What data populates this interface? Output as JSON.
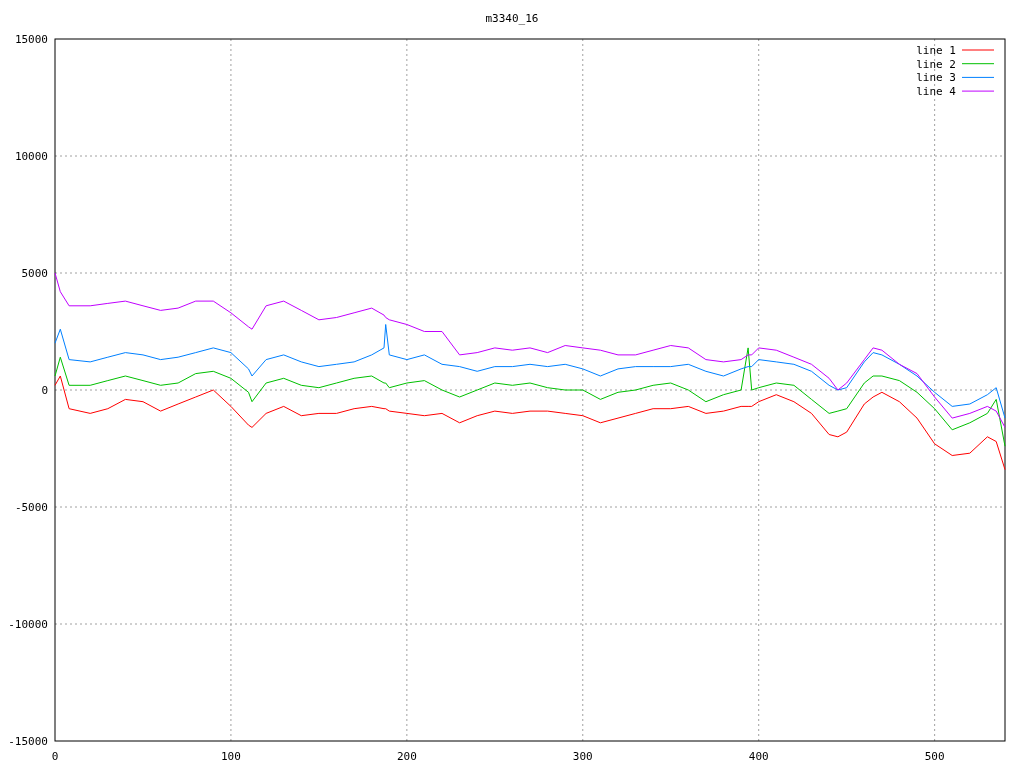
{
  "chart_data": {
    "type": "line",
    "title": "m3340_16",
    "x": [
      0,
      3,
      8,
      20,
      30,
      40,
      50,
      60,
      70,
      80,
      90,
      100,
      110,
      112,
      120,
      130,
      140,
      150,
      160,
      170,
      180,
      187,
      188,
      190,
      200,
      210,
      220,
      230,
      240,
      250,
      260,
      270,
      280,
      290,
      300,
      310,
      320,
      330,
      340,
      350,
      360,
      370,
      380,
      390,
      394,
      396,
      400,
      410,
      420,
      430,
      440,
      445,
      450,
      460,
      465,
      470,
      480,
      490,
      500,
      510,
      520,
      530,
      535,
      540
    ],
    "series": [
      {
        "name": "line 1",
        "color": "#ff0000",
        "values": [
          200,
          600,
          -800,
          -1000,
          -800,
          -400,
          -500,
          -900,
          -600,
          -300,
          0,
          -700,
          -1500,
          -1600,
          -1000,
          -700,
          -1100,
          -1000,
          -1000,
          -800,
          -700,
          -800,
          -800,
          -900,
          -1000,
          -1100,
          -1000,
          -1400,
          -1100,
          -900,
          -1000,
          -900,
          -900,
          -1000,
          -1100,
          -1400,
          -1200,
          -1000,
          -800,
          -800,
          -700,
          -1000,
          -900,
          -700,
          -700,
          -700,
          -500,
          -200,
          -500,
          -1000,
          -1900,
          -2000,
          -1800,
          -600,
          -300,
          -100,
          -500,
          -1200,
          -2300,
          -2800,
          -2700,
          -2000,
          -2200,
          -3400
        ]
      },
      {
        "name": "line 2",
        "color": "#00c000",
        "values": [
          600,
          1400,
          200,
          200,
          400,
          600,
          400,
          200,
          300,
          700,
          800,
          500,
          -100,
          -500,
          300,
          500,
          200,
          100,
          300,
          500,
          600,
          300,
          300,
          100,
          300,
          400,
          0,
          -300,
          0,
          300,
          200,
          300,
          100,
          0,
          0,
          -400,
          -100,
          0,
          200,
          300,
          0,
          -500,
          -200,
          0,
          1800,
          0,
          100,
          300,
          200,
          -400,
          -1000,
          -900,
          -800,
          300,
          600,
          600,
          400,
          -100,
          -800,
          -1700,
          -1400,
          -1000,
          -400,
          -2400
        ]
      },
      {
        "name": "line 3",
        "color": "#0080ff",
        "values": [
          2000,
          2600,
          1300,
          1200,
          1400,
          1600,
          1500,
          1300,
          1400,
          1600,
          1800,
          1600,
          900,
          600,
          1300,
          1500,
          1200,
          1000,
          1100,
          1200,
          1500,
          1800,
          2800,
          1500,
          1300,
          1500,
          1100,
          1000,
          800,
          1000,
          1000,
          1100,
          1000,
          1100,
          900,
          600,
          900,
          1000,
          1000,
          1000,
          1100,
          800,
          600,
          900,
          1000,
          1000,
          1300,
          1200,
          1100,
          800,
          200,
          0,
          100,
          1200,
          1600,
          1500,
          1100,
          600,
          -100,
          -700,
          -600,
          -200,
          100,
          -1200
        ]
      },
      {
        "name": "line 4",
        "color": "#c000ff",
        "values": [
          5000,
          4200,
          3600,
          3600,
          3700,
          3800,
          3600,
          3400,
          3500,
          3800,
          3800,
          3300,
          2700,
          2600,
          3600,
          3800,
          3400,
          3000,
          3100,
          3300,
          3500,
          3200,
          3100,
          3000,
          2800,
          2500,
          2500,
          1500,
          1600,
          1800,
          1700,
          1800,
          1600,
          1900,
          1800,
          1700,
          1500,
          1500,
          1700,
          1900,
          1800,
          1300,
          1200,
          1300,
          1500,
          1500,
          1800,
          1700,
          1400,
          1100,
          500,
          0,
          300,
          1300,
          1800,
          1700,
          1100,
          700,
          -300,
          -1200,
          -1000,
          -700,
          -900,
          -1600
        ]
      }
    ],
    "xlim": [
      0,
      540
    ],
    "ylim": [
      -15000,
      15000
    ],
    "xticks": [
      0,
      100,
      200,
      300,
      400,
      500
    ],
    "yticks": [
      -15000,
      -10000,
      -5000,
      0,
      5000,
      10000,
      15000
    ],
    "grid": true,
    "legend": true
  }
}
